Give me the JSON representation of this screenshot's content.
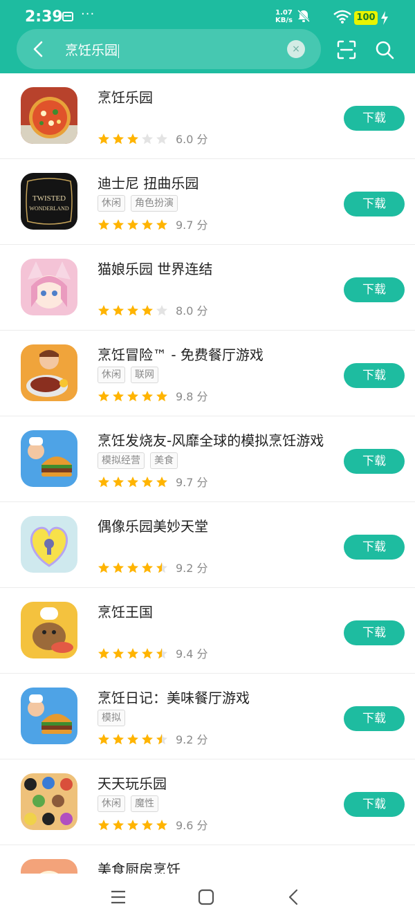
{
  "status_bar": {
    "time": "2:39",
    "dots": "···",
    "net_speed_value": "1.07",
    "net_speed_unit": "KB/s",
    "battery": "100"
  },
  "search": {
    "query": "烹饪乐园",
    "clear_symbol": "×"
  },
  "colors": {
    "brand": "#1ebca0",
    "star_on": "#ffb400",
    "star_off": "#e3e3e3"
  },
  "download_label": "下载",
  "apps": [
    {
      "name": "烹饪乐园",
      "tags": [],
      "rating": 3,
      "score": "6.0 分",
      "icon": "pizza-game-icon"
    },
    {
      "name": "迪士尼 扭曲乐园",
      "tags": [
        "休闲",
        "角色扮演"
      ],
      "rating": 5,
      "score": "9.7 分",
      "icon": "twisted-wonderland-icon"
    },
    {
      "name": "猫娘乐园 世界连结",
      "tags": [],
      "rating": 4,
      "score": "8.0 分",
      "icon": "catgirl-anime-icon"
    },
    {
      "name": "烹饪冒险™ - 免费餐厅游戏",
      "tags": [
        "休闲",
        "联网"
      ],
      "rating": 5,
      "score": "9.8 分",
      "icon": "chef-steak-icon"
    },
    {
      "name": "烹饪发烧友-风靡全球的模拟烹饪游戏",
      "tags": [
        "模拟经营",
        "美食"
      ],
      "rating": 5,
      "score": "9.7 分",
      "icon": "chef-burger-icon"
    },
    {
      "name": "偶像乐园美妙天堂",
      "tags": [],
      "rating": 4.5,
      "score": "9.2 分",
      "icon": "heart-keyhole-icon"
    },
    {
      "name": "烹饪王国",
      "tags": [],
      "rating": 4.5,
      "score": "9.4 分",
      "icon": "capybara-chef-icon"
    },
    {
      "name": "烹饪日记：美味餐厅游戏",
      "tags": [
        "模拟"
      ],
      "rating": 4.5,
      "score": "9.2 分",
      "icon": "chef-burger-icon"
    },
    {
      "name": "天天玩乐园",
      "tags": [
        "休闲",
        "魔性"
      ],
      "rating": 5,
      "score": "9.6 分",
      "icon": "crowd-faces-icon"
    },
    {
      "name": "美食厨房烹饪",
      "tags": [],
      "rating": 0,
      "score": "",
      "icon": "kitchen-food-icon"
    }
  ]
}
